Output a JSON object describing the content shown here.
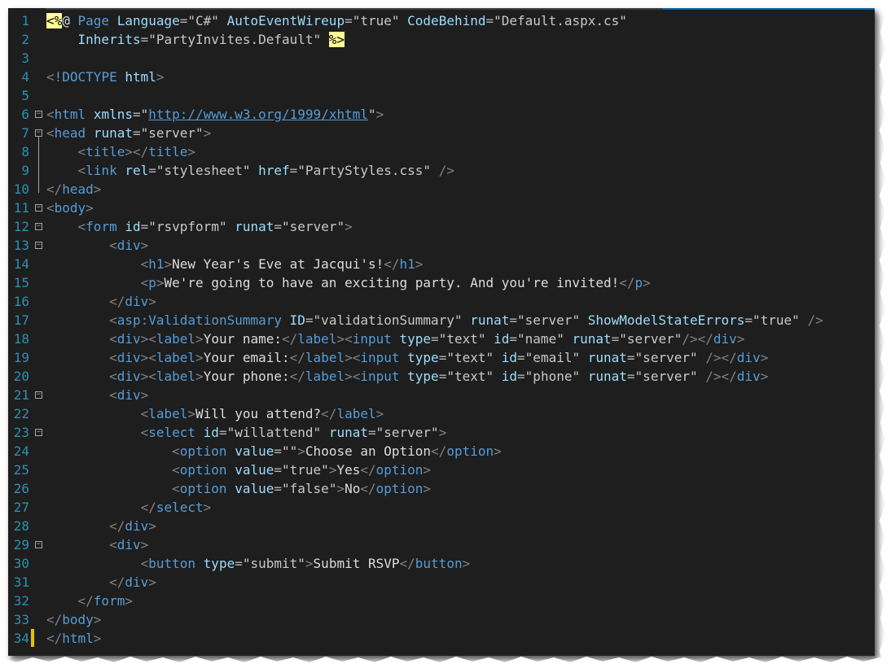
{
  "lines": [
    {
      "n": "1",
      "parts": [
        [
          "dir",
          "<%"
        ],
        [
          "txt",
          "@ "
        ],
        [
          "t",
          "Page "
        ],
        [
          "a",
          "Language"
        ],
        [
          "e",
          "="
        ],
        [
          "sv",
          "\"C#\" "
        ],
        [
          "a",
          "AutoEventWireup"
        ],
        [
          "e",
          "="
        ],
        [
          "sv",
          "\"true\" "
        ],
        [
          "a",
          "CodeBehind"
        ],
        [
          "e",
          "="
        ],
        [
          "sv",
          "\"Default.aspx.cs\""
        ]
      ]
    },
    {
      "n": "2",
      "parts": [
        [
          "txt",
          "    "
        ],
        [
          "a",
          "Inherits"
        ],
        [
          "e",
          "="
        ],
        [
          "sv",
          "\"PartyInvites.Default\" "
        ],
        [
          "dir",
          "%>"
        ]
      ]
    },
    {
      "n": "3",
      "parts": []
    },
    {
      "n": "4",
      "parts": [
        [
          "b",
          "<"
        ],
        [
          "t",
          "!DOCTYPE "
        ],
        [
          "a",
          "html"
        ],
        [
          "b",
          ">"
        ]
      ]
    },
    {
      "n": "5",
      "parts": []
    },
    {
      "n": "6",
      "parts": [
        [
          "b",
          "<"
        ],
        [
          "t",
          "html "
        ],
        [
          "a",
          "xmlns"
        ],
        [
          "e",
          "="
        ],
        [
          "sv",
          "\""
        ],
        [
          "u",
          "http://www.w3.org/1999/xhtml"
        ],
        [
          "sv",
          "\""
        ],
        [
          "b",
          ">"
        ]
      ]
    },
    {
      "n": "7",
      "parts": [
        [
          "b",
          "<"
        ],
        [
          "t",
          "head "
        ],
        [
          "a",
          "runat"
        ],
        [
          "e",
          "="
        ],
        [
          "sv",
          "\"server\""
        ],
        [
          "b",
          ">"
        ]
      ]
    },
    {
      "n": "8",
      "parts": [
        [
          "txt",
          "    "
        ],
        [
          "b",
          "<"
        ],
        [
          "t",
          "title"
        ],
        [
          "b",
          "></"
        ],
        [
          "t",
          "title"
        ],
        [
          "b",
          ">"
        ]
      ]
    },
    {
      "n": "9",
      "parts": [
        [
          "txt",
          "    "
        ],
        [
          "b",
          "<"
        ],
        [
          "t",
          "link "
        ],
        [
          "a",
          "rel"
        ],
        [
          "e",
          "="
        ],
        [
          "sv",
          "\"stylesheet\" "
        ],
        [
          "a",
          "href"
        ],
        [
          "e",
          "="
        ],
        [
          "sv",
          "\"PartyStyles.css\" "
        ],
        [
          "b",
          "/>"
        ]
      ]
    },
    {
      "n": "10",
      "parts": [
        [
          "b",
          "</"
        ],
        [
          "t",
          "head"
        ],
        [
          "b",
          ">"
        ]
      ]
    },
    {
      "n": "11",
      "parts": [
        [
          "b",
          "<"
        ],
        [
          "t",
          "body"
        ],
        [
          "b",
          ">"
        ]
      ]
    },
    {
      "n": "12",
      "parts": [
        [
          "txt",
          "    "
        ],
        [
          "b",
          "<"
        ],
        [
          "t",
          "form "
        ],
        [
          "a",
          "id"
        ],
        [
          "e",
          "="
        ],
        [
          "sv",
          "\"rsvpform\" "
        ],
        [
          "a",
          "runat"
        ],
        [
          "e",
          "="
        ],
        [
          "sv",
          "\"server\""
        ],
        [
          "b",
          ">"
        ]
      ]
    },
    {
      "n": "13",
      "parts": [
        [
          "txt",
          "        "
        ],
        [
          "b",
          "<"
        ],
        [
          "t",
          "div"
        ],
        [
          "b",
          ">"
        ]
      ]
    },
    {
      "n": "14",
      "parts": [
        [
          "txt",
          "            "
        ],
        [
          "b",
          "<"
        ],
        [
          "t",
          "h1"
        ],
        [
          "b",
          ">"
        ],
        [
          "txt",
          "New Year's Eve at Jacqui's!"
        ],
        [
          "b",
          "</"
        ],
        [
          "t",
          "h1"
        ],
        [
          "b",
          ">"
        ]
      ]
    },
    {
      "n": "15",
      "parts": [
        [
          "txt",
          "            "
        ],
        [
          "b",
          "<"
        ],
        [
          "t",
          "p"
        ],
        [
          "b",
          ">"
        ],
        [
          "txt",
          "We're going to have an exciting party. And you're invited!"
        ],
        [
          "b",
          "</"
        ],
        [
          "t",
          "p"
        ],
        [
          "b",
          ">"
        ]
      ]
    },
    {
      "n": "16",
      "parts": [
        [
          "txt",
          "        "
        ],
        [
          "b",
          "</"
        ],
        [
          "t",
          "div"
        ],
        [
          "b",
          ">"
        ]
      ]
    },
    {
      "n": "17",
      "parts": [
        [
          "txt",
          "        "
        ],
        [
          "b",
          "<"
        ],
        [
          "t",
          "asp"
        ],
        [
          "b",
          ":"
        ],
        [
          "t",
          "ValidationSummary "
        ],
        [
          "a",
          "ID"
        ],
        [
          "e",
          "="
        ],
        [
          "sv",
          "\"validationSummary\" "
        ],
        [
          "a",
          "runat"
        ],
        [
          "e",
          "="
        ],
        [
          "sv",
          "\"server\" "
        ],
        [
          "a",
          "ShowModelStateErrors"
        ],
        [
          "e",
          "="
        ],
        [
          "sv",
          "\"true\" "
        ],
        [
          "b",
          "/>"
        ]
      ]
    },
    {
      "n": "18",
      "parts": [
        [
          "txt",
          "        "
        ],
        [
          "b",
          "<"
        ],
        [
          "t",
          "div"
        ],
        [
          "b",
          "><"
        ],
        [
          "t",
          "label"
        ],
        [
          "b",
          ">"
        ],
        [
          "txt",
          "Your name:"
        ],
        [
          "b",
          "</"
        ],
        [
          "t",
          "label"
        ],
        [
          "b",
          "><"
        ],
        [
          "t",
          "input "
        ],
        [
          "a",
          "type"
        ],
        [
          "e",
          "="
        ],
        [
          "sv",
          "\"text\" "
        ],
        [
          "a",
          "id"
        ],
        [
          "e",
          "="
        ],
        [
          "sv",
          "\"name\" "
        ],
        [
          "a",
          "runat"
        ],
        [
          "e",
          "="
        ],
        [
          "sv",
          "\"server\""
        ],
        [
          "b",
          "/></"
        ],
        [
          "t",
          "div"
        ],
        [
          "b",
          ">"
        ]
      ]
    },
    {
      "n": "19",
      "parts": [
        [
          "txt",
          "        "
        ],
        [
          "b",
          "<"
        ],
        [
          "t",
          "div"
        ],
        [
          "b",
          "><"
        ],
        [
          "t",
          "label"
        ],
        [
          "b",
          ">"
        ],
        [
          "txt",
          "Your email:"
        ],
        [
          "b",
          "</"
        ],
        [
          "t",
          "label"
        ],
        [
          "b",
          "><"
        ],
        [
          "t",
          "input "
        ],
        [
          "a",
          "type"
        ],
        [
          "e",
          "="
        ],
        [
          "sv",
          "\"text\" "
        ],
        [
          "a",
          "id"
        ],
        [
          "e",
          "="
        ],
        [
          "sv",
          "\"email\" "
        ],
        [
          "a",
          "runat"
        ],
        [
          "e",
          "="
        ],
        [
          "sv",
          "\"server\" "
        ],
        [
          "b",
          "/></"
        ],
        [
          "t",
          "div"
        ],
        [
          "b",
          ">"
        ]
      ]
    },
    {
      "n": "20",
      "parts": [
        [
          "txt",
          "        "
        ],
        [
          "b",
          "<"
        ],
        [
          "t",
          "div"
        ],
        [
          "b",
          "><"
        ],
        [
          "t",
          "label"
        ],
        [
          "b",
          ">"
        ],
        [
          "txt",
          "Your phone:"
        ],
        [
          "b",
          "</"
        ],
        [
          "t",
          "label"
        ],
        [
          "b",
          "><"
        ],
        [
          "t",
          "input "
        ],
        [
          "a",
          "type"
        ],
        [
          "e",
          "="
        ],
        [
          "sv",
          "\"text\" "
        ],
        [
          "a",
          "id"
        ],
        [
          "e",
          "="
        ],
        [
          "sv",
          "\"phone\" "
        ],
        [
          "a",
          "runat"
        ],
        [
          "e",
          "="
        ],
        [
          "sv",
          "\"server\" "
        ],
        [
          "b",
          "/></"
        ],
        [
          "t",
          "div"
        ],
        [
          "b",
          ">"
        ]
      ]
    },
    {
      "n": "21",
      "parts": [
        [
          "txt",
          "        "
        ],
        [
          "b",
          "<"
        ],
        [
          "t",
          "div"
        ],
        [
          "b",
          ">"
        ]
      ]
    },
    {
      "n": "22",
      "parts": [
        [
          "txt",
          "            "
        ],
        [
          "b",
          "<"
        ],
        [
          "t",
          "label"
        ],
        [
          "b",
          ">"
        ],
        [
          "txt",
          "Will you attend?"
        ],
        [
          "b",
          "</"
        ],
        [
          "t",
          "label"
        ],
        [
          "b",
          ">"
        ]
      ]
    },
    {
      "n": "23",
      "parts": [
        [
          "txt",
          "            "
        ],
        [
          "b",
          "<"
        ],
        [
          "t",
          "select "
        ],
        [
          "a",
          "id"
        ],
        [
          "e",
          "="
        ],
        [
          "sv",
          "\"willattend\" "
        ],
        [
          "a",
          "runat"
        ],
        [
          "e",
          "="
        ],
        [
          "sv",
          "\"server\""
        ],
        [
          "b",
          ">"
        ]
      ]
    },
    {
      "n": "24",
      "parts": [
        [
          "txt",
          "                "
        ],
        [
          "b",
          "<"
        ],
        [
          "t",
          "option "
        ],
        [
          "a",
          "value"
        ],
        [
          "e",
          "="
        ],
        [
          "sv",
          "\"\""
        ],
        [
          "b",
          ">"
        ],
        [
          "txt",
          "Choose an Option"
        ],
        [
          "b",
          "</"
        ],
        [
          "t",
          "option"
        ],
        [
          "b",
          ">"
        ]
      ]
    },
    {
      "n": "25",
      "parts": [
        [
          "txt",
          "                "
        ],
        [
          "b",
          "<"
        ],
        [
          "t",
          "option "
        ],
        [
          "a",
          "value"
        ],
        [
          "e",
          "="
        ],
        [
          "sv",
          "\"true\""
        ],
        [
          "b",
          ">"
        ],
        [
          "txt",
          "Yes"
        ],
        [
          "b",
          "</"
        ],
        [
          "t",
          "option"
        ],
        [
          "b",
          ">"
        ]
      ]
    },
    {
      "n": "26",
      "parts": [
        [
          "txt",
          "                "
        ],
        [
          "b",
          "<"
        ],
        [
          "t",
          "option "
        ],
        [
          "a",
          "value"
        ],
        [
          "e",
          "="
        ],
        [
          "sv",
          "\"false\""
        ],
        [
          "b",
          ">"
        ],
        [
          "txt",
          "No"
        ],
        [
          "b",
          "</"
        ],
        [
          "t",
          "option"
        ],
        [
          "b",
          ">"
        ]
      ]
    },
    {
      "n": "27",
      "parts": [
        [
          "txt",
          "            "
        ],
        [
          "b",
          "</"
        ],
        [
          "t",
          "select"
        ],
        [
          "b",
          ">"
        ]
      ]
    },
    {
      "n": "28",
      "parts": [
        [
          "txt",
          "        "
        ],
        [
          "b",
          "</"
        ],
        [
          "t",
          "div"
        ],
        [
          "b",
          ">"
        ]
      ]
    },
    {
      "n": "29",
      "parts": [
        [
          "txt",
          "        "
        ],
        [
          "b",
          "<"
        ],
        [
          "t",
          "div"
        ],
        [
          "b",
          ">"
        ]
      ]
    },
    {
      "n": "30",
      "parts": [
        [
          "txt",
          "            "
        ],
        [
          "b",
          "<"
        ],
        [
          "t",
          "button "
        ],
        [
          "a",
          "type"
        ],
        [
          "e",
          "="
        ],
        [
          "sv",
          "\"submit\""
        ],
        [
          "b",
          ">"
        ],
        [
          "txt",
          "Submit RSVP"
        ],
        [
          "b",
          "</"
        ],
        [
          "t",
          "button"
        ],
        [
          "b",
          ">"
        ]
      ]
    },
    {
      "n": "31",
      "parts": [
        [
          "txt",
          "        "
        ],
        [
          "b",
          "</"
        ],
        [
          "t",
          "div"
        ],
        [
          "b",
          ">"
        ]
      ]
    },
    {
      "n": "32",
      "parts": [
        [
          "txt",
          "    "
        ],
        [
          "b",
          "</"
        ],
        [
          "t",
          "form"
        ],
        [
          "b",
          ">"
        ]
      ]
    },
    {
      "n": "33",
      "parts": [
        [
          "b",
          "</"
        ],
        [
          "t",
          "body"
        ],
        [
          "b",
          ">"
        ]
      ]
    },
    {
      "n": "34",
      "parts": [
        [
          "b",
          "</"
        ],
        [
          "t",
          "html"
        ],
        [
          "b",
          ">"
        ]
      ]
    }
  ],
  "fold_lines": [
    "6",
    "7",
    "11",
    "12",
    "13",
    "21",
    "23",
    "29"
  ],
  "colors": {
    "background": "#1e1e1e",
    "line_number": "#2b91af",
    "tag": "#569cd6",
    "attribute": "#9cdcfe",
    "directive_bg": "#ffff99"
  }
}
